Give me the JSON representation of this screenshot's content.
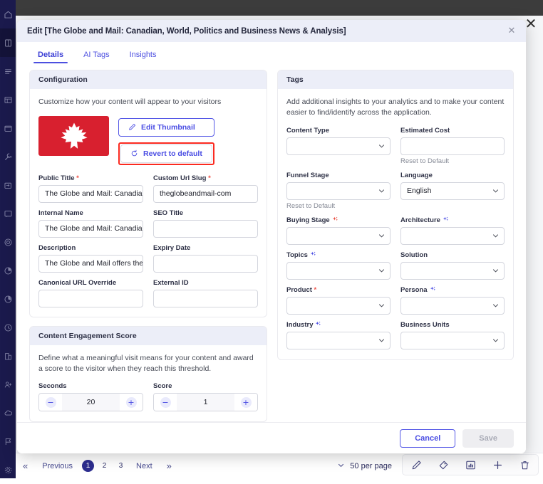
{
  "modal": {
    "title": "Edit [The Globe and Mail: Canadian, World, Politics and Business News & Analysis]",
    "close_icon": "close-icon",
    "tabs": [
      {
        "label": "Details",
        "active": true
      },
      {
        "label": "AI Tags",
        "active": false
      },
      {
        "label": "Insights",
        "active": false
      }
    ],
    "footer": {
      "cancel_label": "Cancel",
      "save_label": "Save"
    }
  },
  "configuration": {
    "heading": "Configuration",
    "description": "Customize how your content will appear to your visitors",
    "thumbnail": {
      "icon": "maple-leaf-icon",
      "bg_color": "#d8202f",
      "leaf_color": "#ffffff"
    },
    "edit_thumbnail_label": "Edit Thumbnail",
    "edit_thumbnail_icon": "pencil-icon",
    "revert_label": "Revert to default",
    "revert_icon": "revert-icon",
    "highlight_color": "#fb2a20",
    "fields": [
      {
        "label": "Public Title",
        "required": true,
        "value": "The Globe and Mail: Canadian,",
        "type": "text"
      },
      {
        "label": "Custom Url Slug",
        "required": true,
        "value": "theglobeandmail-com",
        "type": "text"
      },
      {
        "label": "Internal Name",
        "required": false,
        "value": "The Globe and Mail: Canadian,",
        "type": "text"
      },
      {
        "label": "SEO Title",
        "required": false,
        "value": "",
        "type": "text"
      },
      {
        "label": "Description",
        "required": false,
        "value": "The Globe and Mail offers the ",
        "type": "text"
      },
      {
        "label": "Expiry Date",
        "required": false,
        "value": "",
        "type": "text"
      },
      {
        "label": "Canonical URL Override",
        "required": false,
        "value": "",
        "type": "text"
      },
      {
        "label": "External ID",
        "required": false,
        "value": "",
        "type": "text"
      }
    ]
  },
  "engagement": {
    "heading": "Content Engagement Score",
    "description": "Define what a meaningful visit means for your content and award a score to the visitor when they reach this threshold.",
    "seconds": {
      "label": "Seconds",
      "value": "20",
      "minus": "−",
      "plus": "+"
    },
    "score": {
      "label": "Score",
      "value": "1",
      "minus": "−",
      "plus": "+"
    }
  },
  "tags": {
    "heading": "Tags",
    "description": "Add additional insights to your analytics and to make your content easier to find/identify across the application.",
    "reset_label": "Reset to Default",
    "fields": [
      {
        "label": "Content Type",
        "required": false,
        "value": "",
        "type": "select",
        "sparkle": null,
        "reset": false
      },
      {
        "label": "Estimated Cost",
        "required": false,
        "value": "",
        "type": "text",
        "sparkle": null,
        "reset": true
      },
      {
        "label": "Funnel Stage",
        "required": false,
        "value": "",
        "type": "select",
        "sparkle": null,
        "reset": true
      },
      {
        "label": "Language",
        "required": false,
        "value": "English",
        "type": "select",
        "sparkle": null,
        "reset": false
      },
      {
        "label": "Buying Stage",
        "required": false,
        "value": "",
        "type": "select",
        "sparkle": "#e8493c",
        "reset": false
      },
      {
        "label": "Architecture",
        "required": false,
        "value": "",
        "type": "select",
        "sparkle": "#4a4de3",
        "reset": false
      },
      {
        "label": "Topics",
        "required": false,
        "value": "",
        "type": "select",
        "sparkle": "#4a4de3",
        "reset": false
      },
      {
        "label": "Solution",
        "required": false,
        "value": "",
        "type": "select",
        "sparkle": null,
        "reset": false
      },
      {
        "label": "Product",
        "required": true,
        "value": "",
        "type": "select",
        "sparkle": null,
        "reset": false
      },
      {
        "label": "Persona",
        "required": false,
        "value": "",
        "type": "select",
        "sparkle": "#4a4de3",
        "reset": false
      },
      {
        "label": "Industry",
        "required": false,
        "value": "",
        "type": "select",
        "sparkle": "#4a4de3",
        "reset": false
      },
      {
        "label": "Business Units",
        "required": false,
        "value": "",
        "type": "select",
        "sparkle": null,
        "reset": false
      }
    ]
  },
  "background": {
    "close_icon": "close-icon",
    "pagination": {
      "first_label": "«",
      "previous_label": "Previous",
      "pages": [
        "1",
        "2",
        "3"
      ],
      "current_page": "1",
      "next_label": "Next",
      "last_label": "»",
      "per_page_label": "50 per page"
    },
    "action_icons": [
      "pencil-icon",
      "tag-icon",
      "chart-icon",
      "plus-icon",
      "trash-icon"
    ],
    "sidebar_icons": [
      "home-icon",
      "book-icon",
      "list-icon",
      "table-icon",
      "window-icon",
      "tools-icon",
      "import-icon",
      "message-icon",
      "target-icon",
      "pie-icon",
      "donut-icon",
      "clock-icon",
      "building-icon",
      "person-add-icon",
      "cloud-icon",
      "flag-icon",
      "settings-icon"
    ]
  }
}
